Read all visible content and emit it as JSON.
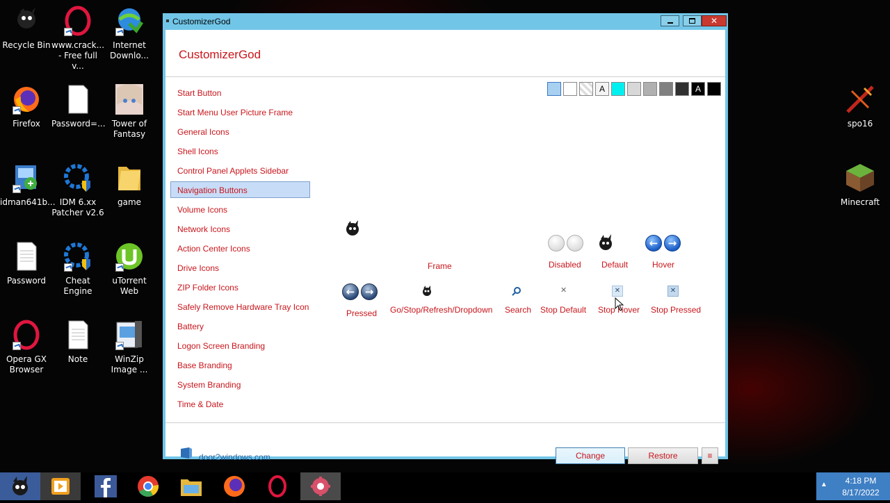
{
  "desktop": {
    "icons": [
      {
        "label": "Recycle Bin",
        "icon": "recycle-bin-icon"
      },
      {
        "label": "www.crack...\n- Free full v...",
        "icon": "opera-icon"
      },
      {
        "label": "Internet\nDownlo...",
        "icon": "idm-icon"
      },
      {
        "label": "Firefox",
        "icon": "firefox-icon"
      },
      {
        "label": "Password=...",
        "icon": "text-file-icon"
      },
      {
        "label": "Tower of\nFantasy",
        "icon": "game-icon"
      },
      {
        "label": "idman641b...",
        "icon": "installer-icon"
      },
      {
        "label": "IDM 6.xx\nPatcher v2.6",
        "icon": "patcher-icon"
      },
      {
        "label": "game",
        "icon": "folder-icon"
      },
      {
        "label": "Password",
        "icon": "text-file-icon"
      },
      {
        "label": "Cheat Engine",
        "icon": "cheat-engine-icon"
      },
      {
        "label": "uTorrent\nWeb",
        "icon": "utorrent-icon"
      },
      {
        "label": "Opera GX\nBrowser",
        "icon": "opera-gx-icon"
      },
      {
        "label": "Note",
        "icon": "text-file-icon"
      },
      {
        "label": "WinZip\nImage ...",
        "icon": "winzip-icon"
      },
      {
        "label": "spo16",
        "icon": "spo16-icon"
      },
      {
        "label": "Minecraft",
        "icon": "minecraft-icon"
      }
    ]
  },
  "window": {
    "title": "CustomizerGod",
    "app_title": "CustomizerGod",
    "nav": [
      "Start Button",
      "Start Menu User Picture Frame",
      "General Icons",
      "Shell Icons",
      "Control Panel Applets Sidebar",
      "Navigation Buttons",
      "Volume Icons",
      "Network Icons",
      "Action Center Icons",
      "Drive Icons",
      "ZIP Folder Icons",
      "Safely Remove Hardware Tray Icon",
      "Battery",
      "Logon Screen Branding",
      "Base Branding",
      "System Branding",
      "Time & Date"
    ],
    "selected_nav": "Navigation Buttons",
    "swatches": {
      "colors": [
        "#a8d0f0",
        "#ffffff",
        "#e8e8e8",
        "#f4f4f4",
        "#00f0f0",
        "#d8d8d8",
        "#b0b0b0",
        "#808080",
        "#303030",
        "#000000",
        "#000000"
      ],
      "text_a": "A"
    },
    "previews": {
      "frame": "Frame",
      "disabled": "Disabled",
      "default": "Default",
      "hover": "Hover",
      "pressed": "Pressed",
      "go_stop": "Go/Stop/Refresh/Dropdown",
      "search": "Search",
      "stop_default": "Stop Default",
      "stop_hover": "Stop Hover",
      "stop_pressed": "Stop Pressed"
    },
    "footer": {
      "link": "door2windows.com",
      "change": "Change",
      "restore": "Restore",
      "menu_icon": "≡"
    }
  },
  "tray": {
    "time": "4:18 PM",
    "date": "8/17/2022"
  }
}
